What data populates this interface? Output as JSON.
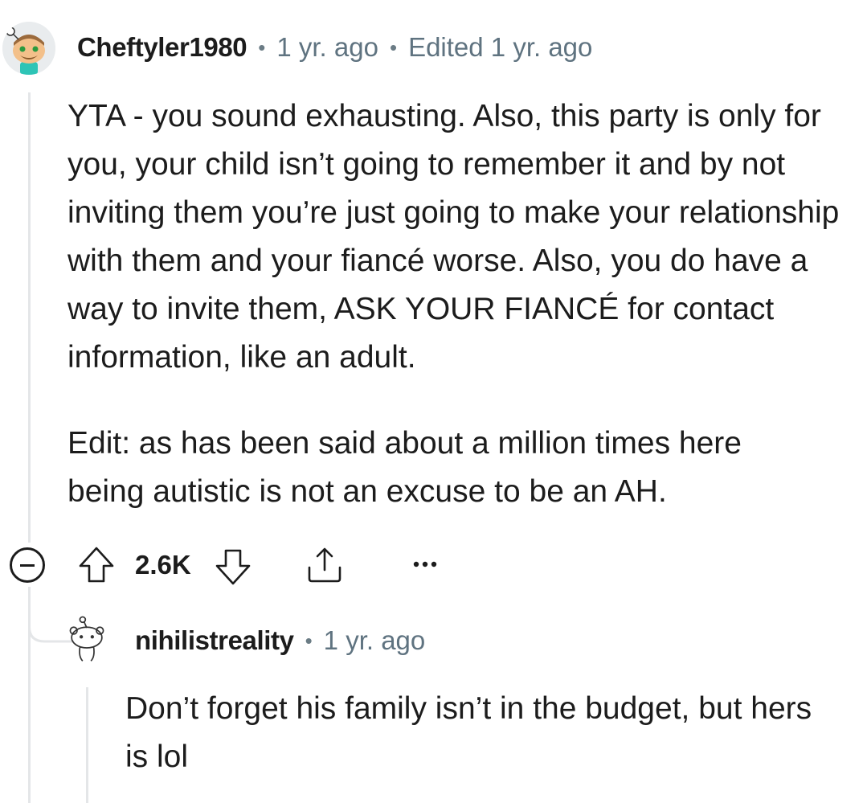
{
  "comment": {
    "username": "Cheftyler1980",
    "age": "1 yr. ago",
    "edited": "Edited 1 yr. ago",
    "paragraphs": [
      "YTA - you sound exhausting. Also, this party is only for you, your child isn’t going to remember it and by not inviting them you’re just going to make your relationship with them and your fiancé worse. Also, you do have a way to invite them, ASK YOUR FIANCÉ for contact information, like an adult.",
      "Edit: as has been said about a million times here being autistic is not an excuse to be an AH."
    ],
    "score": "2.6K"
  },
  "reply": {
    "username": "nihilistreality",
    "age": "1 yr. ago",
    "text": "Don’t forget his family isn’t in the budget, but hers is lol"
  },
  "icons": {
    "collapse": "collapse-minus-icon",
    "upvote": "upvote-arrow-icon",
    "downvote": "downvote-arrow-icon",
    "share": "share-icon",
    "more": "more-options-icon"
  }
}
